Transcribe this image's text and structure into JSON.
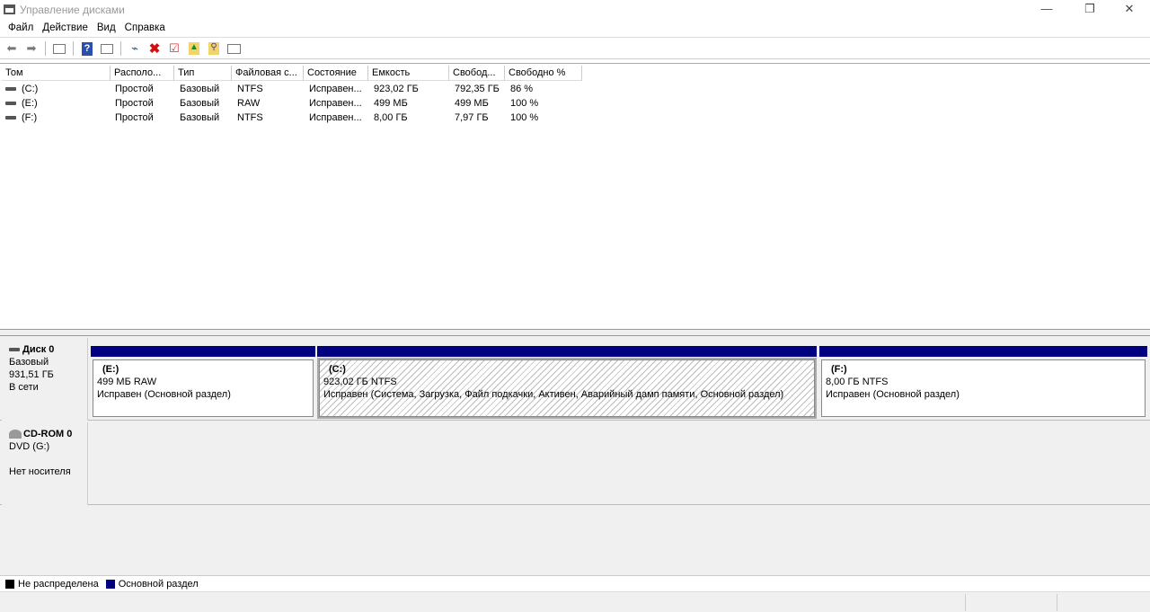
{
  "window": {
    "title": "Управление дисками",
    "minimize": "—",
    "restore": "❐",
    "close": "✕"
  },
  "menu": [
    "Файл",
    "Действие",
    "Вид",
    "Справка"
  ],
  "toolbar": [
    "back-icon",
    "forward-icon",
    "console-tree-icon",
    "help-icon",
    "action-pane-icon",
    "connect-disk-icon",
    "delete-icon",
    "properties-icon",
    "folder-up-icon",
    "folder-search-icon",
    "settings-list-icon"
  ],
  "colors": {
    "primary_partition": "#000080",
    "unallocated": "#000000"
  },
  "volumes": {
    "columns": [
      "Том",
      "Располо...",
      "Тип",
      "Файловая с...",
      "Состояние",
      "Емкость",
      "Свобод...",
      "Свободно %"
    ],
    "rows": [
      [
        "(C:)",
        "Простой",
        "Базовый",
        "NTFS",
        "Исправен...",
        "923,02 ГБ",
        "792,35 ГБ",
        "86 %"
      ],
      [
        "(E:)",
        "Простой",
        "Базовый",
        "RAW",
        "Исправен...",
        "499 МБ",
        "499 МБ",
        "100 %"
      ],
      [
        "(F:)",
        "Простой",
        "Базовый",
        "NTFS",
        "Исправен...",
        "8,00 ГБ",
        "7,97 ГБ",
        "100 %"
      ]
    ]
  },
  "disks": [
    {
      "name": "Диск 0",
      "type": "Базовый",
      "size": "931,51 ГБ",
      "status": "В сети",
      "partitions": [
        {
          "name": "(E:)",
          "size": "499 МБ RAW",
          "status": "Исправен (Основной раздел)"
        },
        {
          "name": "(C:)",
          "size": "923,02 ГБ NTFS",
          "status": "Исправен (Система, Загрузка, Файл подкачки, Активен, Аварийный дамп памяти, Основной раздел)"
        },
        {
          "name": "(F:)",
          "size": "8,00 ГБ NTFS",
          "status": "Исправен (Основной раздел)"
        }
      ]
    },
    {
      "name": "CD-ROM 0",
      "type": "DVD (G:)",
      "status": "Нет носителя"
    }
  ],
  "legend": [
    "Не распределена",
    "Основной раздел"
  ]
}
